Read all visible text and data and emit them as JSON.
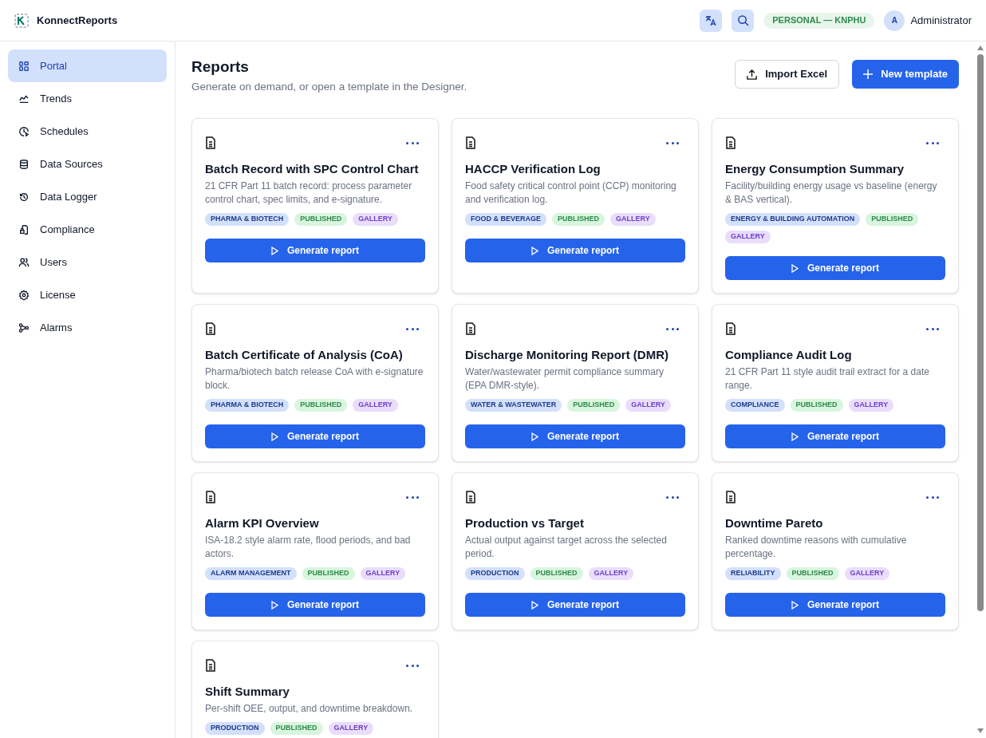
{
  "app": {
    "title": "KonnectReports",
    "workspace": "PERSONAL — KNPHU",
    "user": {
      "initial": "A",
      "name": "Administrator"
    }
  },
  "sidebar": {
    "items": [
      {
        "label": "Portal",
        "selected": true
      },
      {
        "label": "Trends",
        "selected": false
      },
      {
        "label": "Schedules",
        "selected": false
      },
      {
        "label": "Data Sources",
        "selected": false
      },
      {
        "label": "Data Logger",
        "selected": false
      },
      {
        "label": "Compliance",
        "selected": false
      },
      {
        "label": "Users",
        "selected": false
      },
      {
        "label": "License",
        "selected": false
      },
      {
        "label": "Alarms",
        "selected": false
      }
    ]
  },
  "page": {
    "title": "Reports",
    "subtitle": "Generate on demand, or open a template in the Designer.",
    "buttons": [
      {
        "label": "Import Excel",
        "kind": "secondary"
      },
      {
        "label": "New template",
        "kind": "primary"
      }
    ]
  },
  "cards": [
    {
      "title": "Batch Record with SPC Control Chart",
      "description": "21 CFR Part 11 batch record: process parameter control chart, spec limits, and e-signature.",
      "tags": [
        {
          "label": "PHARMA & BIOTECH",
          "kind": "category"
        },
        {
          "label": "PUBLISHED",
          "kind": "status"
        },
        {
          "label": "GALLERY",
          "kind": "source"
        }
      ],
      "action": "Generate report"
    },
    {
      "title": "HACCP Verification Log",
      "description": "Food safety critical control point (CCP) monitoring and verification log.",
      "tags": [
        {
          "label": "FOOD & BEVERAGE",
          "kind": "category"
        },
        {
          "label": "PUBLISHED",
          "kind": "status"
        },
        {
          "label": "GALLERY",
          "kind": "source"
        }
      ],
      "action": "Generate report"
    },
    {
      "title": "Energy Consumption Summary",
      "description": "Facility/building energy usage vs baseline (energy & BAS vertical).",
      "tags": [
        {
          "label": "ENERGY & BUILDING AUTOMATION",
          "kind": "category"
        },
        {
          "label": "PUBLISHED",
          "kind": "status"
        },
        {
          "label": "GALLERY",
          "kind": "source"
        }
      ],
      "action": "Generate report"
    },
    {
      "title": "Batch Certificate of Analysis (CoA)",
      "description": "Pharma/biotech batch release CoA with e-signature block.",
      "tags": [
        {
          "label": "PHARMA & BIOTECH",
          "kind": "category"
        },
        {
          "label": "PUBLISHED",
          "kind": "status"
        },
        {
          "label": "GALLERY",
          "kind": "source"
        }
      ],
      "action": "Generate report"
    },
    {
      "title": "Discharge Monitoring Report (DMR)",
      "description": "Water/wastewater permit compliance summary (EPA DMR-style).",
      "tags": [
        {
          "label": "WATER & WASTEWATER",
          "kind": "category"
        },
        {
          "label": "PUBLISHED",
          "kind": "status"
        },
        {
          "label": "GALLERY",
          "kind": "source"
        }
      ],
      "action": "Generate report"
    },
    {
      "title": "Compliance Audit Log",
      "description": "21 CFR Part 11 style audit trail extract for a date range.",
      "tags": [
        {
          "label": "COMPLIANCE",
          "kind": "category"
        },
        {
          "label": "PUBLISHED",
          "kind": "status"
        },
        {
          "label": "GALLERY",
          "kind": "source"
        }
      ],
      "action": "Generate report"
    },
    {
      "title": "Alarm KPI Overview",
      "description": "ISA-18.2 style alarm rate, flood periods, and bad actors.",
      "tags": [
        {
          "label": "ALARM MANAGEMENT",
          "kind": "category"
        },
        {
          "label": "PUBLISHED",
          "kind": "status"
        },
        {
          "label": "GALLERY",
          "kind": "source"
        }
      ],
      "action": "Generate report"
    },
    {
      "title": "Production vs Target",
      "description": "Actual output against target across the selected period.",
      "tags": [
        {
          "label": "PRODUCTION",
          "kind": "category"
        },
        {
          "label": "PUBLISHED",
          "kind": "status"
        },
        {
          "label": "GALLERY",
          "kind": "source"
        }
      ],
      "action": "Generate report"
    },
    {
      "title": "Downtime Pareto",
      "description": "Ranked downtime reasons with cumulative percentage.",
      "tags": [
        {
          "label": "RELIABILITY",
          "kind": "category"
        },
        {
          "label": "PUBLISHED",
          "kind": "status"
        },
        {
          "label": "GALLERY",
          "kind": "source"
        }
      ],
      "action": "Generate report"
    },
    {
      "title": "Shift Summary",
      "description": "Per-shift OEE, output, and downtime breakdown.",
      "tags": [
        {
          "label": "PRODUCTION",
          "kind": "category"
        },
        {
          "label": "PUBLISHED",
          "kind": "status"
        },
        {
          "label": "GALLERY",
          "kind": "source"
        }
      ]
    }
  ]
}
